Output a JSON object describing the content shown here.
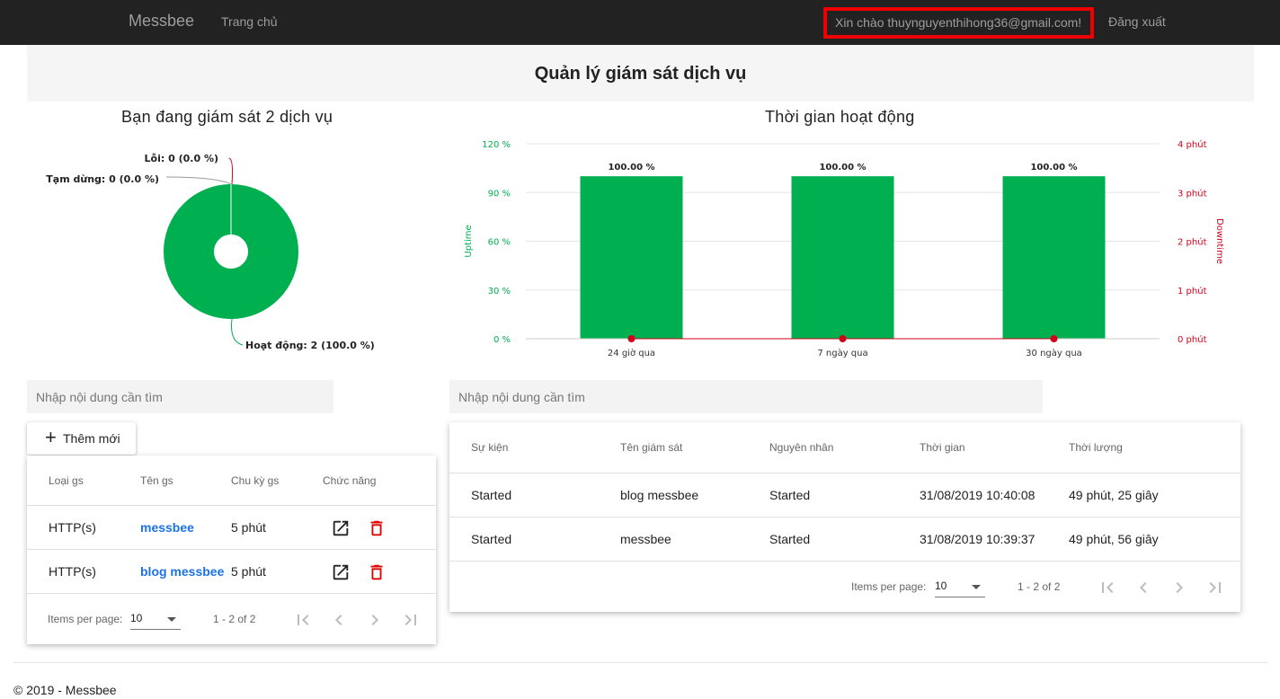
{
  "nav": {
    "brand": "Messbee",
    "home": "Trang chủ",
    "greeting": "Xin chào thuynguyenthihong36@gmail.com!",
    "logout": "Đăng xuất"
  },
  "page_title": "Quản lý giám sát dịch vụ",
  "colors": {
    "up": "#00b050",
    "down": "#d0021b",
    "link": "#1a73e8",
    "delete": "#e00000"
  },
  "chart_data": [
    {
      "type": "pie",
      "title": "Bạn đang giám sát 2 dịch vụ",
      "slices": [
        {
          "label": "Lỗi: 0 (0.0 %)",
          "value": 0,
          "color": "#d0021b"
        },
        {
          "label": "Tạm dừng: 0 (0.0 %)",
          "value": 0,
          "color": "#999999"
        },
        {
          "label": "Hoạt động: 2 (100.0 %)",
          "value": 2,
          "color": "#00b050"
        }
      ]
    },
    {
      "type": "bar",
      "title": "Thời gian hoạt động",
      "categories": [
        "24 giờ qua",
        "7 ngày qua",
        "30 ngày qua"
      ],
      "series": [
        {
          "name": "Uptime",
          "type": "bar",
          "values": [
            100,
            100,
            100
          ],
          "axis": "left",
          "color": "#00b050"
        },
        {
          "name": "Downtime",
          "type": "line",
          "values": [
            0,
            0,
            0
          ],
          "axis": "right",
          "color": "#d0021b"
        }
      ],
      "data_labels": [
        "100.00 %",
        "100.00 %",
        "100.00 %"
      ],
      "ylabel": "Uptime",
      "ylabel_right": "Downtime",
      "ylim": [
        0,
        120
      ],
      "ylim_right": [
        0,
        4
      ],
      "yticks": [
        "0 %",
        "30 %",
        "60 %",
        "90 %",
        "120 %"
      ],
      "yticks_right": [
        "0 phút",
        "1 phút",
        "2 phút",
        "3 phút",
        "4 phút"
      ],
      "grid": true
    }
  ],
  "left_panel": {
    "search_placeholder": "Nhập nội dung cần tìm",
    "add_button": "Thêm mới",
    "headers": [
      "Loại gs",
      "Tên gs",
      "Chu kỳ gs",
      "Chức năng"
    ],
    "rows": [
      {
        "type": "HTTP(s)",
        "name": "messbee",
        "period": "5 phút"
      },
      {
        "type": "HTTP(s)",
        "name": "blog messbee",
        "period": "5 phút"
      }
    ],
    "paginator": {
      "label": "Items per page:",
      "size": "10",
      "range": "1 - 2 of 2"
    }
  },
  "right_panel": {
    "search_placeholder": "Nhập nội dung cần tìm",
    "headers": [
      "Sự kiện",
      "Tên giám sát",
      "Nguyên nhân",
      "Thời gian",
      "Thời lượng"
    ],
    "rows": [
      {
        "event": "Started",
        "monitor": "blog messbee",
        "reason": "Started",
        "time": "31/08/2019 10:40:08",
        "duration": "49 phút, 25 giây"
      },
      {
        "event": "Started",
        "monitor": "messbee",
        "reason": "Started",
        "time": "31/08/2019 10:39:37",
        "duration": "49 phút, 56 giây"
      }
    ],
    "paginator": {
      "label": "Items per page:",
      "size": "10",
      "range": "1 - 2 of 2"
    }
  },
  "footer": "© 2019 - Messbee"
}
